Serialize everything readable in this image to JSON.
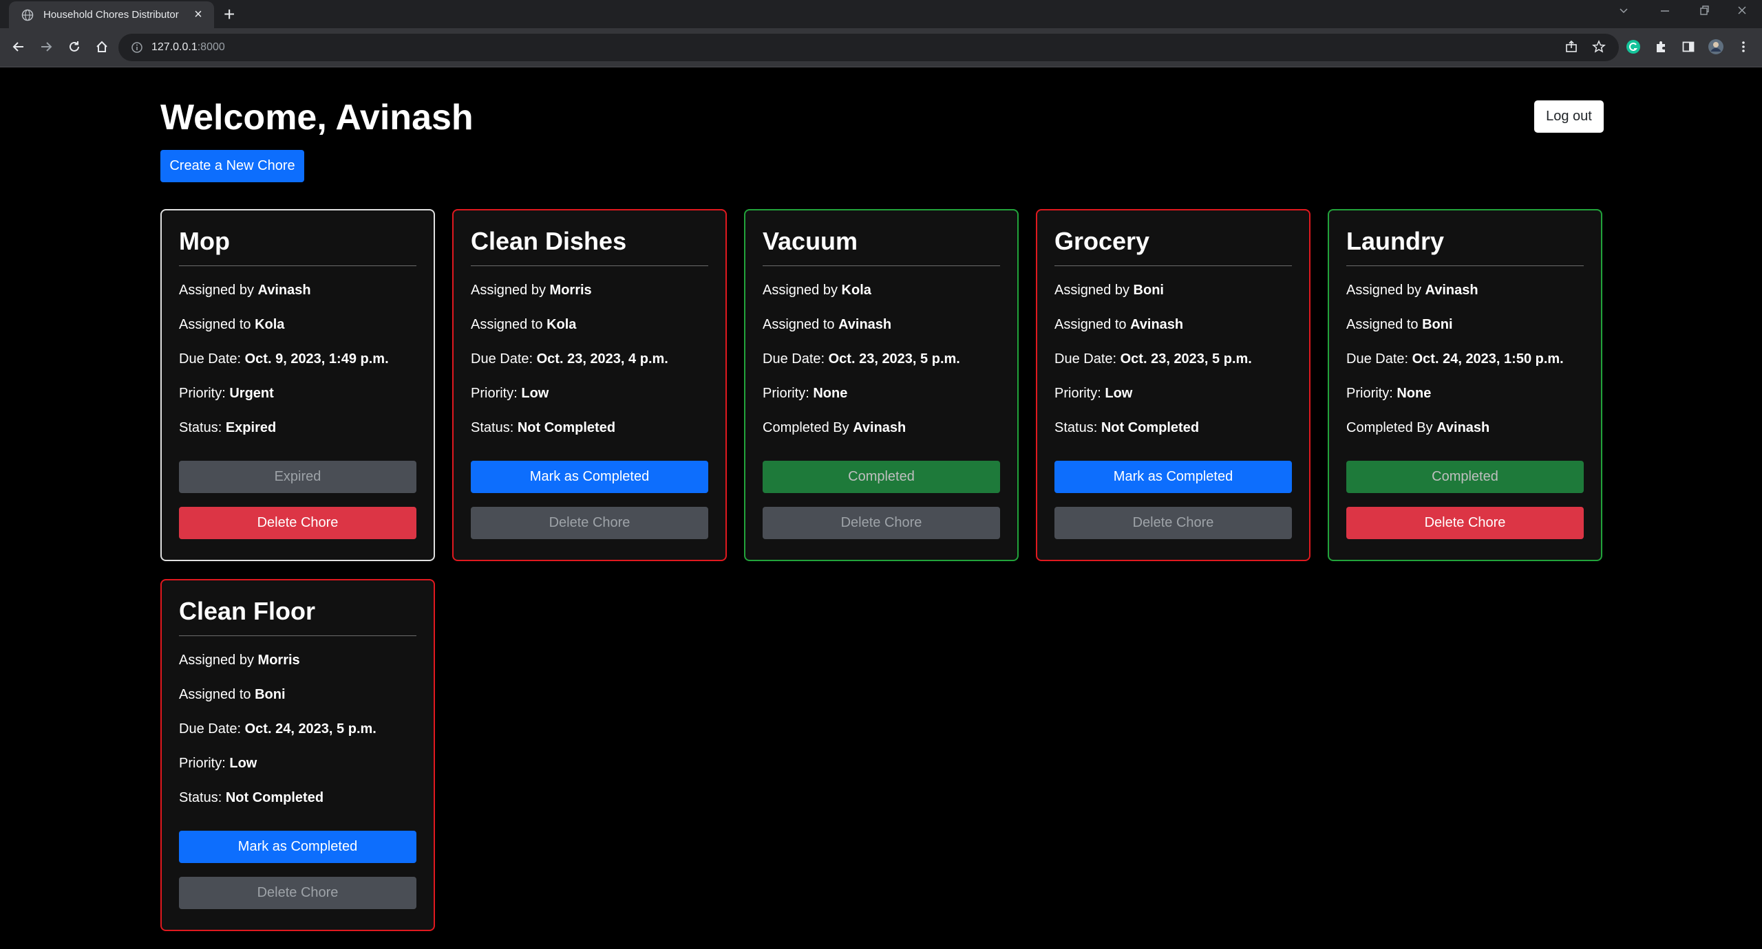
{
  "browser": {
    "tab_title": "Household Chores Distributor",
    "tab_close": "×",
    "new_tab": "+",
    "url_host": "127.0.0.1",
    "url_port": ":8000"
  },
  "header": {
    "welcome": "Welcome, Avinash",
    "logout_label": "Log out",
    "create_label": "Create a New Chore"
  },
  "labels": {
    "assigned_by": "Assigned by",
    "assigned_to": "Assigned to",
    "due_date": "Due Date:",
    "priority": "Priority:",
    "status": "Status:",
    "completed_by": "Completed By",
    "delete": "Delete Chore"
  },
  "chores": [
    {
      "title": "Mop",
      "assigned_by": "Avinash",
      "assigned_to": "Kola",
      "due_date": "Oct. 9, 2023, 1:49 p.m.",
      "priority": "Urgent",
      "status": "Expired",
      "action": "Expired"
    },
    {
      "title": "Clean Dishes",
      "assigned_by": "Morris",
      "assigned_to": "Kola",
      "due_date": "Oct. 23, 2023, 4 p.m.",
      "priority": "Low",
      "status": "Not Completed",
      "action": "Mark as Completed"
    },
    {
      "title": "Vacuum",
      "assigned_by": "Kola",
      "assigned_to": "Avinash",
      "due_date": "Oct. 23, 2023, 5 p.m.",
      "priority": "None",
      "completed_by": "Avinash",
      "action": "Completed"
    },
    {
      "title": "Grocery",
      "assigned_by": "Boni",
      "assigned_to": "Avinash",
      "due_date": "Oct. 23, 2023, 5 p.m.",
      "priority": "Low",
      "status": "Not Completed",
      "action": "Mark as Completed"
    },
    {
      "title": "Laundry",
      "assigned_by": "Avinash",
      "assigned_to": "Boni",
      "due_date": "Oct. 24, 2023, 1:50 p.m.",
      "priority": "None",
      "completed_by": "Avinash",
      "action": "Completed"
    },
    {
      "title": "Clean Floor",
      "assigned_by": "Morris",
      "assigned_to": "Boni",
      "due_date": "Oct. 24, 2023, 5 p.m.",
      "priority": "Low",
      "status": "Not Completed",
      "action": "Mark as Completed"
    }
  ]
}
